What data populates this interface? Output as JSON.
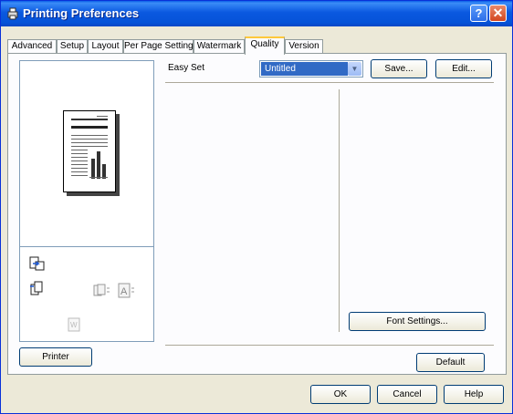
{
  "window": {
    "title": "Printing Preferences",
    "help_glyph": "?",
    "close_glyph": "✕"
  },
  "tabs": [
    {
      "label": "Advanced",
      "active": false
    },
    {
      "label": "Setup",
      "active": false
    },
    {
      "label": "Layout",
      "active": false
    },
    {
      "label": "Per Page Setting",
      "active": false
    },
    {
      "label": "Watermark",
      "active": false
    },
    {
      "label": "Quality",
      "active": true
    },
    {
      "label": "Version",
      "active": false
    }
  ],
  "quality": {
    "easy_set_label": "Easy Set",
    "easy_set_value": "Untitled",
    "save_label": "Save...",
    "edit_label": "Edit...",
    "font_settings_label": "Font Settings...",
    "default_label": "Default",
    "printer_label": "Printer"
  },
  "footer": {
    "ok_label": "OK",
    "cancel_label": "Cancel",
    "help_label": "Help"
  },
  "icons": {
    "preview": "document-preview-icon",
    "printer_output": "printer-output-icon",
    "copy": "copy-icon",
    "font_a": "font-icon"
  },
  "colors": {
    "titlebar": "#0a58e0",
    "selection": "#316ac5",
    "active_tab_accent": "#ffc83c"
  }
}
